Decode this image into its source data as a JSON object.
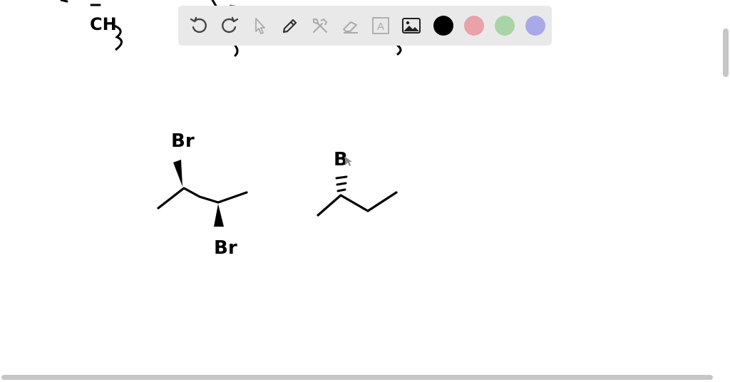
{
  "toolbar": {
    "tools": [
      {
        "name": "undo-icon"
      },
      {
        "name": "redo-icon"
      },
      {
        "name": "pointer-icon"
      },
      {
        "name": "pen-icon"
      },
      {
        "name": "tools-icon"
      },
      {
        "name": "eraser-icon"
      },
      {
        "name": "text-icon",
        "glyph": "A"
      },
      {
        "name": "image-icon"
      }
    ],
    "colors": {
      "black": "#000000",
      "pink": "#e8a2a8",
      "green": "#a8d4a8",
      "purple": "#a9a9e8"
    }
  },
  "whiteboard": {
    "labels": {
      "ch3": "CH",
      "ch3_sub": "3",
      "mol1_top": "Br",
      "mol1_bottom": "Br",
      "mol2_top": "B"
    }
  }
}
